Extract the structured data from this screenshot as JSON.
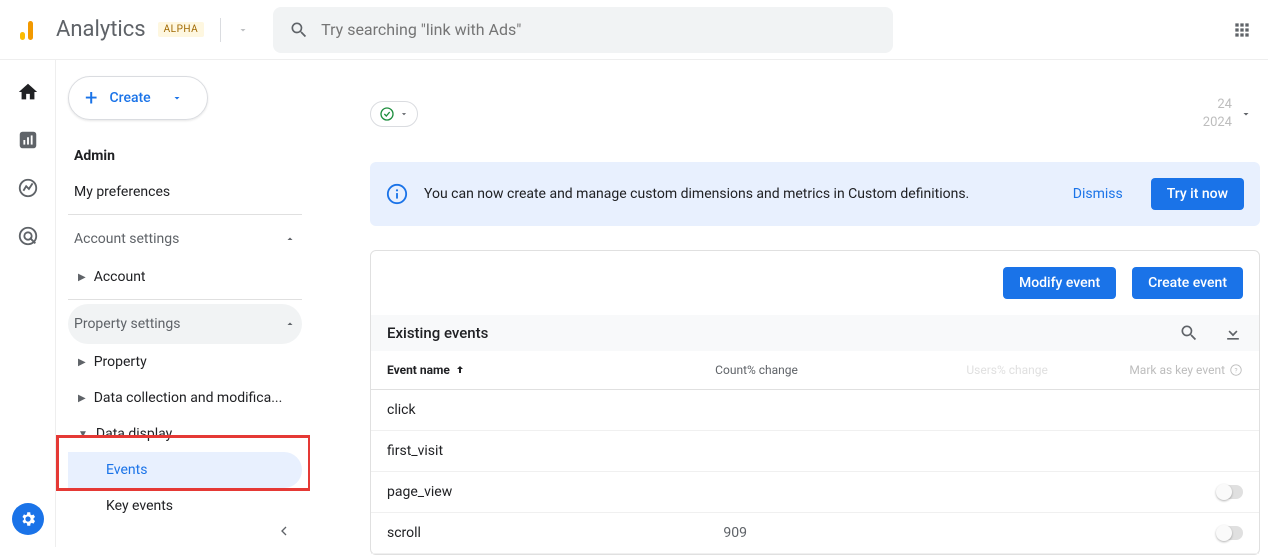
{
  "header": {
    "product": "Analytics",
    "badge": "ALPHA",
    "search_placeholder": "Try searching \"link with Ads\""
  },
  "sidebar": {
    "create_label": "Create",
    "admin": "Admin",
    "my_prefs": "My preferences",
    "account_settings": "Account settings",
    "account": "Account",
    "property_settings": "Property settings",
    "property": "Property",
    "data_collection": "Data collection and modifica...",
    "data_display": "Data display",
    "events": "Events",
    "key_events": "Key events"
  },
  "date": {
    "line1": "24",
    "line2": "2024"
  },
  "banner": {
    "message": "You can now create and manage custom dimensions and metrics in Custom definitions.",
    "dismiss": "Dismiss",
    "cta": "Try it now"
  },
  "actions": {
    "modify": "Modify event",
    "create": "Create event"
  },
  "table": {
    "title": "Existing events",
    "headers": {
      "name": "Event name",
      "count": "Count",
      "pct1": "% change",
      "users": "Users",
      "pct2": "% change",
      "mark": "Mark as key event"
    },
    "rows": [
      {
        "name": "click",
        "count": "",
        "toggle": false
      },
      {
        "name": "first_visit",
        "count": "",
        "toggle": false
      },
      {
        "name": "page_view",
        "count": "",
        "toggle": true
      },
      {
        "name": "scroll",
        "count": "909",
        "toggle": true
      }
    ]
  }
}
